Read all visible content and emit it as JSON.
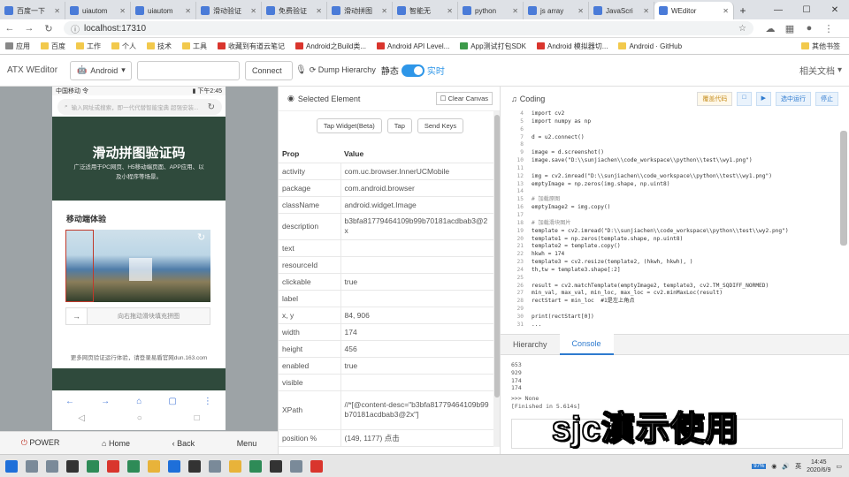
{
  "browser": {
    "tabs": [
      {
        "label": "百度一下",
        "active": false
      },
      {
        "label": "uiautom",
        "active": false
      },
      {
        "label": "uiautom",
        "active": false
      },
      {
        "label": "滑动验证",
        "active": false
      },
      {
        "label": "免费验证",
        "active": false
      },
      {
        "label": "滑动拼图",
        "active": false
      },
      {
        "label": "智能无",
        "active": false
      },
      {
        "label": "python",
        "active": false
      },
      {
        "label": "js array",
        "active": false
      },
      {
        "label": "JavaScri",
        "active": false
      },
      {
        "label": "WEditor",
        "active": true
      }
    ],
    "new_tab": "+",
    "url": "localhost:17310",
    "bookmarks": [
      "应用",
      "百度",
      "工作",
      "个人",
      "技术",
      "工具",
      "收藏到有道云笔记",
      "Android之Build类...",
      "Android API Level...",
      "App测试打包SDK",
      "Android 模拟器切...",
      "Android · GitHub",
      "其他书签"
    ]
  },
  "toolbar": {
    "brand": "ATX WEditor",
    "platform": "Android",
    "serial_value": "",
    "connect": "Connect",
    "dump": "Dump Hierarchy",
    "static_label": "静态",
    "realtime_label": "实时",
    "docs": "相关文档"
  },
  "phone": {
    "status_left": "中国移动 令",
    "status_right": "▮ 下午2:45",
    "search_placeholder": "输入网址或搜索，即一代代替智能宝典 超强安装...",
    "hero_title": "滑动拼图验证码",
    "hero_desc": "广泛适用于PC网页、H5移动端页面、APP应用、以及小程序等场景。",
    "mobile_section": "移动端体验",
    "slider_hint": "向右拖动滑块填充拼图",
    "footer": "更多网页验证运行体验，请登录易盾官网dun.163.com",
    "nav_icons": [
      "←",
      "→",
      "⌂",
      "▢",
      "⋮"
    ],
    "sys_icons": [
      "◁",
      "○",
      "□"
    ]
  },
  "phone_controls": {
    "power": "POWER",
    "home": "Home",
    "back": "Back",
    "menu": "Menu"
  },
  "selected": {
    "header": "Selected Element",
    "clear_canvas": "Clear Canvas",
    "tap_widget": "Tap Widget(Beta)",
    "tap": "Tap",
    "send_keys": "Send Keys",
    "col_prop": "Prop",
    "col_value": "Value",
    "rows": [
      {
        "k": "activity",
        "v": "com.uc.browser.InnerUCMobile"
      },
      {
        "k": "package",
        "v": "com.android.browser"
      },
      {
        "k": "className",
        "v": "android.widget.Image"
      },
      {
        "k": "description",
        "v": "b3bfa81779464109b99b70181acdbab3@2x"
      },
      {
        "k": "text",
        "v": ""
      },
      {
        "k": "resourceId",
        "v": ""
      },
      {
        "k": "clickable",
        "v": "true"
      },
      {
        "k": "label",
        "v": ""
      },
      {
        "k": "x, y",
        "v": "84, 906"
      },
      {
        "k": "width",
        "v": "174"
      },
      {
        "k": "height",
        "v": "456"
      },
      {
        "k": "enabled",
        "v": "true"
      },
      {
        "k": "visible",
        "v": ""
      },
      {
        "k": "XPath",
        "v": "//*[@content-desc=\"b3bfa81779464109b99b70181acdbab3@2x\"]"
      },
      {
        "k": "position %",
        "v": "(149, 1177) 点击"
      }
    ]
  },
  "coding": {
    "header": "Coding",
    "buttons": [
      "覆盖代码",
      "□",
      "▶",
      "选中运行",
      "停止"
    ],
    "line_start": 4,
    "lines": [
      "import cv2",
      "import numpy as np",
      "",
      "d = u2.connect()",
      "",
      "image = d.screenshot()",
      "image.save(\"D:\\\\sunjiachen\\\\code_workspace\\\\python\\\\test\\\\wy1.png\")",
      "",
      "img = cv2.imread(\"D:\\\\sunjiachen\\\\code_workspace\\\\python\\\\test\\\\wy1.png\")",
      "emptyImage = np.zeros(img.shape, np.uint8)",
      "",
      "# 加载原图",
      "emptyImage2 = img.copy()",
      "",
      "# 加载滑块图片",
      "template = cv2.imread(\"D:\\\\sunjiachen\\\\code_workspace\\\\python\\\\test\\\\wy2.png\")",
      "template1 = np.zeros(template.shape, np.uint8)",
      "template2 = template.copy()",
      "hkwh = 174",
      "template3 = cv2.resize(template2, (hkwh, hkwh), )",
      "th,tw = template3.shape[:2]",
      "",
      "result = cv2.matchTemplate(emptyImage2, template3, cv2.TM_SQDIFF_NORMED)",
      "min_val, max_val, min_loc, max_loc = cv2.minMaxLoc(result)",
      "rectStart = min_loc  #1是左上角点",
      "",
      "print(rectStart[0])",
      "..."
    ]
  },
  "console": {
    "tabs": [
      "Hierarchy",
      "Console"
    ],
    "active_tab": "Console",
    "output": [
      "653",
      "929",
      "174",
      "174",
      ">>> None",
      "[Finished in 5.614s]"
    ]
  },
  "watermark": "sjc演示使用",
  "taskbar": {
    "time": "14:45",
    "date": "2020/6/9",
    "battery": "97%",
    "ime": "英"
  }
}
